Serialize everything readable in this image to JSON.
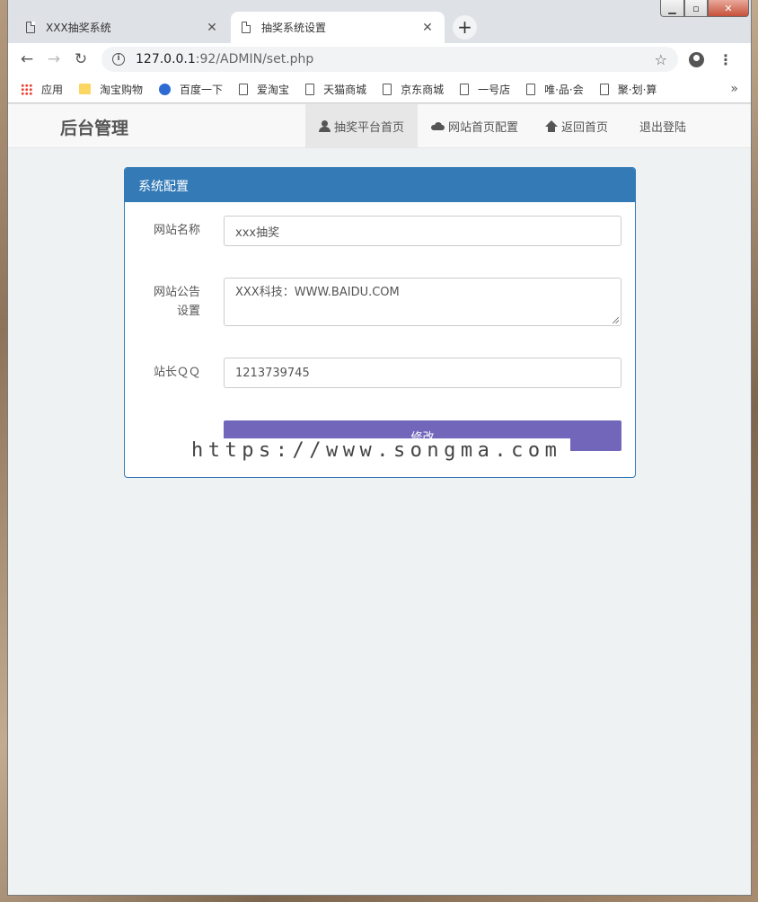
{
  "browser": {
    "tabs": [
      {
        "title": "XXX抽奖系统",
        "active": false
      },
      {
        "title": "抽奖系统设置",
        "active": true
      }
    ],
    "new_tab_label": "+",
    "url_host": "127.0.0.1",
    "url_rest": ":92/ADMIN/set.php",
    "bookmarks": [
      {
        "label": "应用",
        "icon": "apps-icon"
      },
      {
        "label": "淘宝购物",
        "icon": "folder-icon"
      },
      {
        "label": "百度一下",
        "icon": "baidu-icon"
      },
      {
        "label": "爱淘宝",
        "icon": "page-icon"
      },
      {
        "label": "天猫商城",
        "icon": "page-icon"
      },
      {
        "label": "京东商城",
        "icon": "page-icon"
      },
      {
        "label": "一号店",
        "icon": "page-icon"
      },
      {
        "label": "唯·品·会",
        "icon": "page-icon"
      },
      {
        "label": "聚·划·算",
        "icon": "page-icon"
      }
    ],
    "bookmarks_more": "»"
  },
  "navbar": {
    "brand": "后台管理",
    "links": [
      {
        "label": "抽奖平台首页",
        "icon": "user-icon",
        "active": true
      },
      {
        "label": "网站首页配置",
        "icon": "cloud-icon",
        "active": false
      },
      {
        "label": "返回首页",
        "icon": "home-icon",
        "active": false
      },
      {
        "label": "退出登陆",
        "icon": "",
        "active": false
      }
    ]
  },
  "panel": {
    "title": "系统配置",
    "site_name_label": "网站名称",
    "site_name_value": "xxx抽奖",
    "notice_label_line1": "网站公告",
    "notice_label_line2": "设置",
    "notice_value": "XXX科技：WWW.BAIDU.COM",
    "qq_label": "站长ＱＱ",
    "qq_value": "1213739745",
    "submit_label": "修改"
  },
  "watermark": "https://www.songma.com",
  "colors": {
    "panel_primary": "#337ab7",
    "submit_button": "#7266ba",
    "page_background": "#eef2f3"
  }
}
